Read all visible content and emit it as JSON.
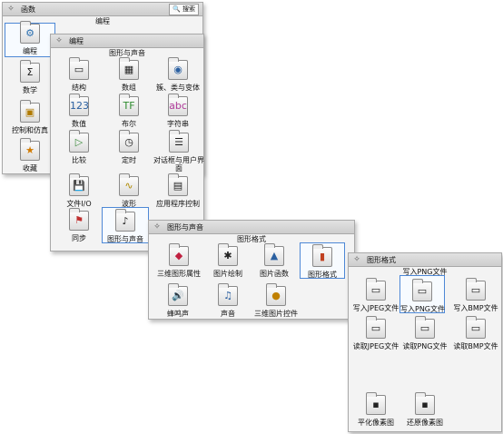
{
  "panel_functions": {
    "title": "函数",
    "search_label": "搜索",
    "subtitle": "编程",
    "items": [
      "编程",
      "数学",
      "控制和仿真",
      "收藏"
    ]
  },
  "panel_programming": {
    "title": "编程",
    "subtitle": "图形与声音",
    "items": [
      "结构",
      "数组",
      "簇、类与变体",
      "数值",
      "布尔",
      "字符串",
      "比较",
      "定时",
      "对话框与用户界面",
      "文件I/O",
      "波形",
      "应用程序控制",
      "同步",
      "图形与声音"
    ]
  },
  "panel_graphics": {
    "title": "图形与声音",
    "subtitle": "图形格式",
    "items": [
      "三维图形属性",
      "图片绘制",
      "图片函数",
      "图形格式",
      "蜂鸣声",
      "声音",
      "三维图片控件"
    ]
  },
  "panel_formats": {
    "title": "图形格式",
    "subtitle": "写入PNG文件",
    "items": [
      "写入JPEG文件",
      "写入PNG文件",
      "写入BMP文件",
      "读取JPEG文件",
      "读取PNG文件",
      "读取BMP文件",
      "平化像素图",
      "还原像素图"
    ]
  },
  "icons": {
    "pin": "push-pin-icon",
    "search": "magnifier-icon"
  },
  "colors": {
    "selection_border": "#4d88d6",
    "titlebar": "#d6d6d6",
    "panel_bg": "#f3f3f3"
  }
}
